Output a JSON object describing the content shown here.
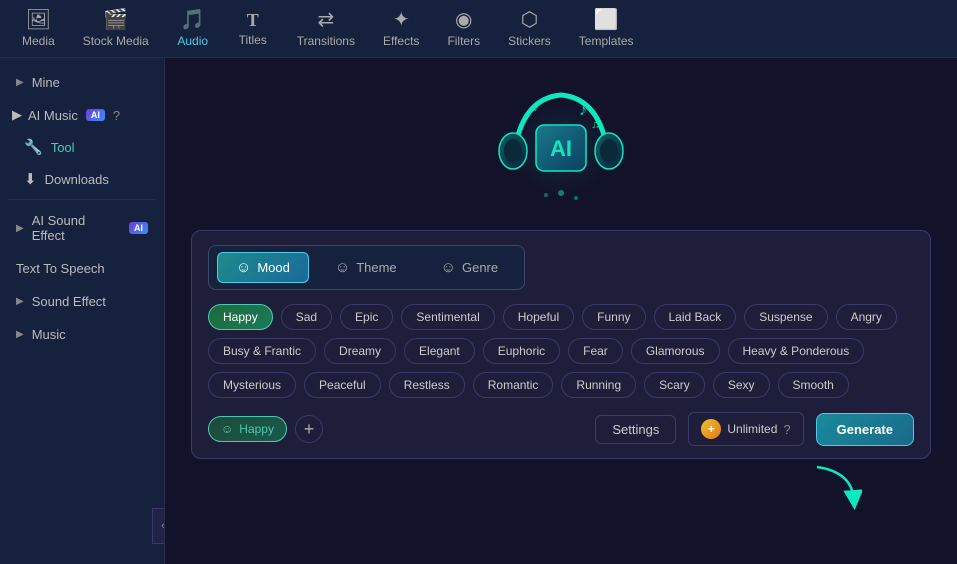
{
  "nav": {
    "items": [
      {
        "id": "media",
        "label": "Media",
        "icon": "🖼",
        "active": false
      },
      {
        "id": "stock-media",
        "label": "Stock Media",
        "icon": "🎬",
        "active": false
      },
      {
        "id": "audio",
        "label": "Audio",
        "icon": "🎵",
        "active": true
      },
      {
        "id": "titles",
        "label": "Titles",
        "icon": "T",
        "active": false
      },
      {
        "id": "transitions",
        "label": "Transitions",
        "icon": "↔",
        "active": false
      },
      {
        "id": "effects",
        "label": "Effects",
        "icon": "✦",
        "active": false
      },
      {
        "id": "filters",
        "label": "Filters",
        "icon": "◉",
        "active": false
      },
      {
        "id": "stickers",
        "label": "Stickers",
        "icon": "⬡",
        "active": false
      },
      {
        "id": "templates",
        "label": "Templates",
        "icon": "⬜",
        "active": false
      }
    ]
  },
  "sidebar": {
    "mine_label": "Mine",
    "ai_music_label": "AI Music",
    "tool_label": "Tool",
    "downloads_label": "Downloads",
    "ai_sound_effect_label": "AI Sound Effect",
    "text_to_speech_label": "Text To Speech",
    "sound_effect_label": "Sound Effect",
    "music_label": "Music"
  },
  "panel": {
    "tabs": [
      {
        "id": "mood",
        "label": "Mood",
        "icon": "☺",
        "active": true
      },
      {
        "id": "theme",
        "label": "Theme",
        "icon": "☺",
        "active": false
      },
      {
        "id": "genre",
        "label": "Genre",
        "icon": "☺",
        "active": false
      }
    ],
    "mood_tags_row1": [
      "Happy",
      "Sad",
      "Epic",
      "Sentimental",
      "Hopeful",
      "Funny",
      "Laid Back",
      "Suspense",
      "Angry"
    ],
    "mood_tags_row2": [
      "Busy & Frantic",
      "Dreamy",
      "Elegant",
      "Euphoric",
      "Fear",
      "Glamorous",
      "Heavy & Ponderous"
    ],
    "mood_tags_row3": [
      "Mysterious",
      "Peaceful",
      "Restless",
      "Romantic",
      "Running",
      "Scary",
      "Sexy",
      "Smooth"
    ],
    "selected_tag": "Happy",
    "settings_label": "Settings",
    "unlimited_label": "Unlimited",
    "generate_label": "Generate"
  },
  "colors": {
    "active_tab_border": "#4ec9e8",
    "active_tag_bg": "#1e6a3a",
    "generate_bg": "#1a8a9a",
    "unlimited_icon": "#f0c030"
  }
}
